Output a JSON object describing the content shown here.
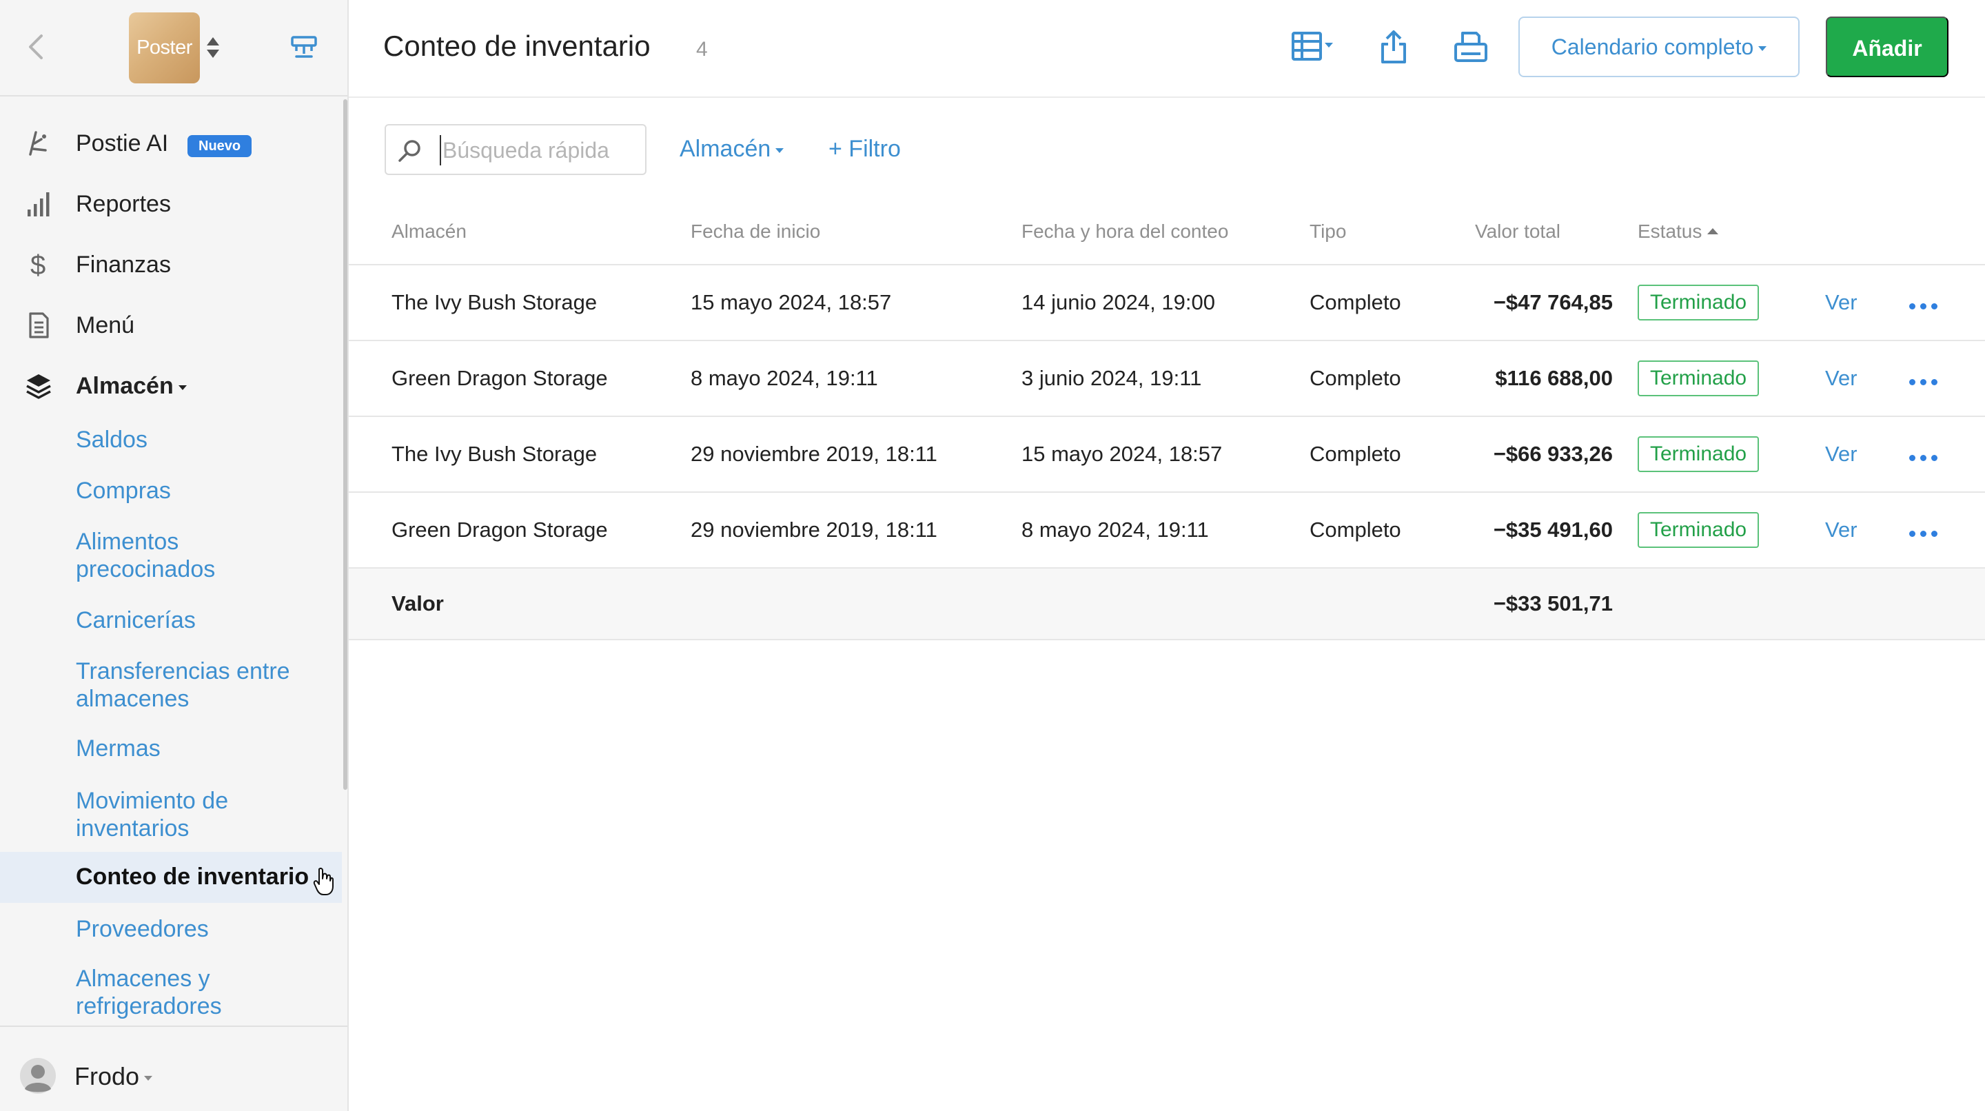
{
  "sidebar": {
    "logo_text": "Poster",
    "main_items": [
      {
        "label": "Postie AI",
        "badge": "Nuevo",
        "icon": "ai-sparkle-icon"
      },
      {
        "label": "Reportes",
        "icon": "bar-chart-icon"
      },
      {
        "label": "Finanzas",
        "icon": "dollar-icon"
      },
      {
        "label": "Menú",
        "icon": "document-icon"
      },
      {
        "label": "Almacén",
        "icon": "layers-icon",
        "expanded": true
      }
    ],
    "sub_items": [
      "Saldos",
      "Compras",
      "Alimentos precocinados",
      "Carnicerías",
      "Transferencias entre almacenes",
      "Mermas",
      "Movimiento de inventarios",
      "Conteo de inventario",
      "Proveedores",
      "Almacenes y refrigeradores"
    ],
    "active_sub_item": "Conteo de inventario",
    "user_name": "Frodo"
  },
  "header": {
    "title": "Conteo de inventario",
    "count": "4",
    "calendar_label": "Calendario completo",
    "add_label": "Añadir"
  },
  "toolbar": {
    "search_placeholder": "Búsqueda rápida",
    "filter_almacen": "Almacén",
    "filter_add": "+ Filtro"
  },
  "table": {
    "columns": [
      "Almacén",
      "Fecha de inicio",
      "Fecha y hora del conteo",
      "Tipo",
      "Valor total",
      "Estatus"
    ],
    "sort_column": "Estatus",
    "sort_direction": "ascending",
    "rows": [
      {
        "almacen": "The Ivy Bush Storage",
        "inicio": "15 mayo 2024, 18:57",
        "conteo": "14 junio 2024, 19:00",
        "tipo": "Completo",
        "valor": "−$47 764,85",
        "estatus": "Terminado",
        "accion": "Ver"
      },
      {
        "almacen": "Green Dragon Storage",
        "inicio": "8 mayo 2024, 19:11",
        "conteo": "3 junio 2024, 19:11",
        "tipo": "Completo",
        "valor": "$116 688,00",
        "estatus": "Terminado",
        "accion": "Ver"
      },
      {
        "almacen": "The Ivy Bush Storage",
        "inicio": "29 noviembre 2019, 18:11",
        "conteo": "15 mayo 2024, 18:57",
        "tipo": "Completo",
        "valor": "−$66 933,26",
        "estatus": "Terminado",
        "accion": "Ver"
      },
      {
        "almacen": "Green Dragon Storage",
        "inicio": "29 noviembre 2019, 18:11",
        "conteo": "8 mayo 2024, 19:11",
        "tipo": "Completo",
        "valor": "−$35 491,60",
        "estatus": "Terminado",
        "accion": "Ver"
      }
    ],
    "total_label": "Valor",
    "total_value": "−$33 501,71"
  },
  "colors": {
    "accent": "#3d8fd0",
    "primary_button": "#1faa4b",
    "negative": "#d64545",
    "status": "#22a048",
    "badge": "#2f7fdf"
  }
}
